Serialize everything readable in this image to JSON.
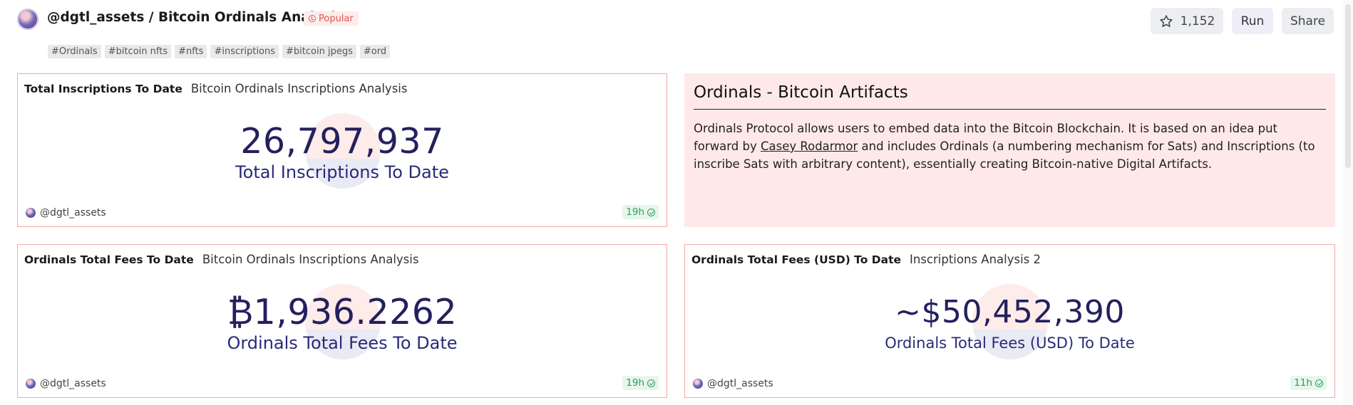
{
  "header": {
    "title": "@dgtl_assets / Bitcoin Ordinals Analysis",
    "badge": "Popular",
    "tags": [
      "#Ordinals",
      "#bitcoin nfts",
      "#nfts",
      "#inscriptions",
      "#bitcoin jpegs",
      "#ord"
    ],
    "star_count": "1,152",
    "run_label": "Run",
    "share_label": "Share"
  },
  "panels": [
    {
      "title": "Total Inscriptions To Date",
      "subtitle": "Bitcoin Ordinals Inscriptions Analysis",
      "value": "26,797,937",
      "label": "Total Inscriptions To Date",
      "author": "@dgtl_assets",
      "freshness": "19h"
    },
    {
      "title": "Ordinals Total Fees To Date",
      "subtitle": "Bitcoin Ordinals Inscriptions Analysis",
      "value": "₿1,936.2262",
      "label": "Ordinals Total Fees To Date",
      "author": "@dgtl_assets",
      "freshness": "19h"
    },
    {
      "title": "Ordinals Total Fees (USD) To Date",
      "subtitle": "Inscriptions Analysis 2",
      "value": "~$50,452,390",
      "label": "Ordinals Total Fees (USD) To Date",
      "author": "@dgtl_assets",
      "freshness": "11h"
    }
  ],
  "text_panel": {
    "heading": "Ordinals - Bitcoin Artifacts",
    "body_start": "Ordinals Protocol allows users to embed data into the Bitcoin Blockchain. It is based on an idea put forward by ",
    "link": "Casey Rodarmor",
    "body_end": " and includes Ordinals (a numbering mechanism for Sats) and Inscriptions (to inscribe Sats with arbitrary content), essentially creating Bitcoin-native Digital Artifacts."
  },
  "colors": {
    "panel_border": "#f4a7a7",
    "number_color": "#24205e",
    "text_panel_bg": "#fee9e8",
    "badge_red": "#e2564d",
    "fresh_green": "#2e9e5b"
  },
  "icons": [
    "avatar",
    "clock-icon",
    "star-icon",
    "check-circle-icon"
  ]
}
